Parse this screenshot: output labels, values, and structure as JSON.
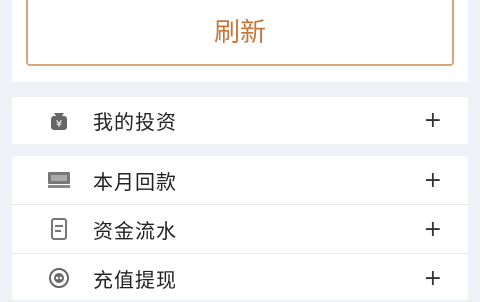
{
  "refresh": {
    "label": "刷新"
  },
  "menu": {
    "items": [
      {
        "label": "我的投资",
        "action": "+",
        "icon": "money-bag-icon"
      },
      {
        "label": "本月回款",
        "action": "+",
        "icon": "cash-icon"
      },
      {
        "label": "资金流水",
        "action": "+",
        "icon": "document-icon"
      },
      {
        "label": "充值提现",
        "action": "+",
        "icon": "wallet-icon"
      }
    ]
  },
  "colors": {
    "accent": "#c8773a",
    "button_border": "#d6a77b",
    "page_background": "#eef2f7"
  }
}
